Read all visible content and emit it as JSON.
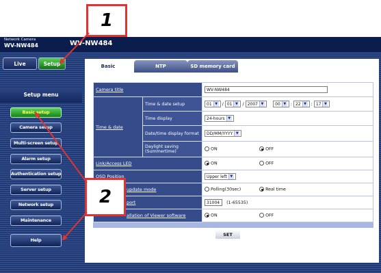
{
  "header": {
    "brand_small": "Network Camera",
    "brand_model": "WV-NW484",
    "product_name": "WV-NW484"
  },
  "top_tabs": {
    "live": "Live",
    "setup": "Setup"
  },
  "sidebar": {
    "title": "Setup menu",
    "items": [
      {
        "label": "Basic setup",
        "active": true
      },
      {
        "label": "Camera setup",
        "active": false
      },
      {
        "label": "Multi-screen setup",
        "active": false
      },
      {
        "label": "Alarm setup",
        "active": false
      },
      {
        "label": "Authentication setup",
        "active": false
      },
      {
        "label": "Server setup",
        "active": false
      },
      {
        "label": "Network setup",
        "active": false
      },
      {
        "label": "Maintenance",
        "active": false
      }
    ],
    "help": "Help"
  },
  "content_tabs": [
    "Basic",
    "NTP",
    "SD memory card"
  ],
  "form": {
    "camera_title": {
      "label": "Camera title",
      "value": "WV-NW484"
    },
    "time_date": {
      "label": "Time & date",
      "setup_label": "Time & date setup",
      "month": "01",
      "day": "01",
      "year": "2007",
      "hour": "00",
      "minute": "22",
      "second": "17",
      "slash": "/",
      "colon": ":",
      "display_label": "Time display",
      "display_value": "24-hours",
      "format_label": "Date/time display format",
      "format_value": "DD/MM/YYYY",
      "dst_label": "Daylight saving (Summertime)",
      "dst_on": "ON",
      "dst_off": "OFF"
    },
    "link_led": {
      "label": "Link/Access LED",
      "on": "ON",
      "off": "OFF"
    },
    "osd_position": {
      "label": "OSD Position",
      "value": "Upper left"
    },
    "update_mode": {
      "label": "update mode",
      "opt1": "Polling(30sec)",
      "opt2": "Real time"
    },
    "port": {
      "label": "port",
      "value": "31004",
      "range": "(1-65535)"
    },
    "viewer_install": {
      "label": "allation of Viewer software",
      "on": "ON",
      "off": "OFF"
    }
  },
  "set_button": "SET",
  "callouts": {
    "one": "1",
    "two": "2"
  },
  "colors": {
    "accent_green": "#2fa82f",
    "callout_red": "#e03333",
    "nav_blue": "#1f3a78"
  }
}
